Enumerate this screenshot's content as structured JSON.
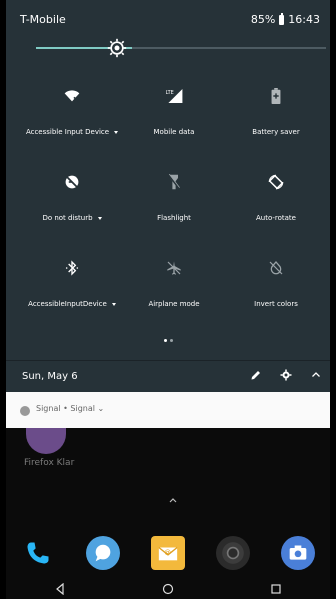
{
  "status": {
    "carrier": "T-Mobile",
    "battery": "85%",
    "time": "16:43"
  },
  "brightness": {
    "level": 0.33
  },
  "tiles": [
    {
      "label": "Accessible Input Device",
      "icon": "wifi-off-icon",
      "dropdown": true
    },
    {
      "label": "Mobile data",
      "icon": "lte-signal-icon",
      "dropdown": false
    },
    {
      "label": "Battery saver",
      "icon": "battery-plus-icon",
      "dropdown": false
    },
    {
      "label": "Do not disturb",
      "icon": "dnd-off-icon",
      "dropdown": true
    },
    {
      "label": "Flashlight",
      "icon": "flashlight-off-icon",
      "dropdown": false
    },
    {
      "label": "Auto-rotate",
      "icon": "rotate-icon",
      "dropdown": false
    },
    {
      "label": "AccessibleInputDevice",
      "icon": "bluetooth-icon",
      "dropdown": true
    },
    {
      "label": "Airplane mode",
      "icon": "airplane-off-icon",
      "dropdown": false
    },
    {
      "label": "Invert colors",
      "icon": "invert-colors-off-icon",
      "dropdown": false
    }
  ],
  "pager": {
    "pages": 2,
    "current": 0
  },
  "date_bar": {
    "date": "Sun, May 6"
  },
  "notification": {
    "app": "Signal",
    "separator": "•",
    "title": "Signal"
  },
  "home": {
    "app_label": "Firefox Klar"
  },
  "colors": {
    "qs_bg": "#263238",
    "accent": "#80cbc4",
    "notif_bg": "#fafafa"
  }
}
